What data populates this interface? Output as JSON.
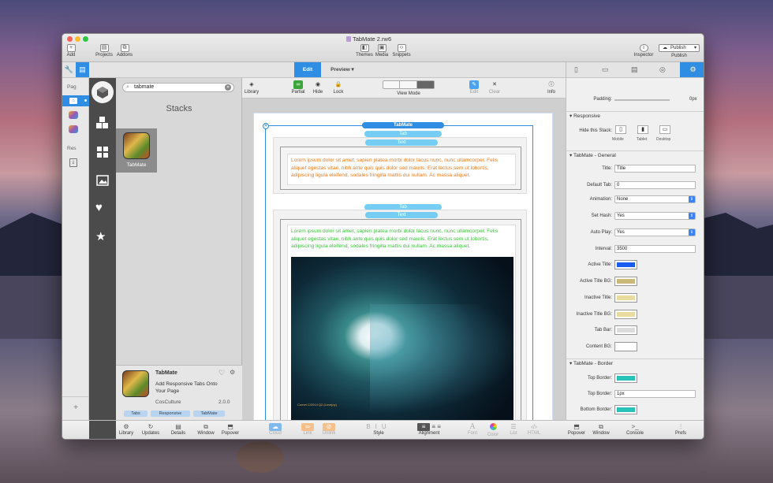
{
  "window": {
    "title": "TabMate 2.rw6",
    "toolbar_left": [
      "Add",
      "Projects",
      "Addons"
    ],
    "toolbar_center": [
      "Themes",
      "Media",
      "Snippets"
    ],
    "toolbar_right": [
      "Inspector",
      "Publish"
    ],
    "publish_button": "Publish"
  },
  "modes": {
    "edit": "Edit",
    "preview": "Preview"
  },
  "sidebar": {
    "pages_label": "Pag",
    "resources_label": "Res"
  },
  "library": {
    "search_value": "tabmate",
    "heading": "Stacks",
    "tile_label": "TabMate",
    "detail": {
      "name": "TabMate",
      "description": "Add Responsive Tabs Onto Your Page",
      "author": "CosCulture",
      "version": "2.0.0",
      "tags": [
        "Tabs",
        "Responsive",
        "TabMate"
      ]
    }
  },
  "stack_toolbar": [
    "Library",
    "Partial",
    "Hide",
    "Lock",
    "View Mode",
    "Edit",
    "Clear",
    "Info"
  ],
  "canvas": {
    "top_pill": "TabMate",
    "tab_pill": "Tab",
    "text_pill": "Text",
    "lorem": "Lorem ipsum dolor sit amet, sapien platea morbi dolor lacus nunc, nunc ullamcorper. Felis aliquet egestas vitae, nibh ante quis quis dolor sed mauris. Erat lectus sem ut lobortis, adipiscing ligula eleifend, sodales fringilla mattis dui nullam. Ac massa aliquet."
  },
  "inspector": {
    "padding_label": "Padding:",
    "padding_unit": "0px",
    "responsive": {
      "header": "Responsive",
      "hide_label": "Hide this Stack:",
      "devices": [
        "Mobile",
        "Tablet",
        "Desktop"
      ]
    },
    "general": {
      "header": "TabMate - General",
      "title_label": "Title:",
      "title_value": "Title",
      "default_tab_label": "Default Tab:",
      "default_tab_value": "0",
      "animation_label": "Animation:",
      "animation_value": "None",
      "set_hash_label": "Set Hash:",
      "set_hash_value": "Yes",
      "auto_play_label": "Auto Play:",
      "auto_play_value": "Yes",
      "interval_label": "Interval:",
      "interval_value": "3500",
      "active_title_label": "Active Title:",
      "active_title_bg_label": "Active Title BG:",
      "inactive_title_label": "Inactive Title:",
      "inactive_title_bg_label": "Inactive Title BG:",
      "tab_bar_label": "Tab Bar:",
      "content_bg_label": "Content BG:"
    },
    "border": {
      "header": "TabMate - Border",
      "top_border_label": "Top Border:",
      "top_border_width_label": "Top Border:",
      "top_border_width_value": "1px",
      "bottom_border_label": "Bottom Border:"
    }
  },
  "colors": {
    "accent": "#2f8de4",
    "active_title": "#1a5cf0",
    "active_title_bg": "#c8b97a",
    "inactive_title": "#e8dca0",
    "inactive_title_bg": "#e8dca0",
    "tab_bar": "#dcdcdc",
    "content_bg": "#ffffff",
    "top_border": "#27c2b8",
    "bottom_border": "#27c2b8",
    "lorem_orange": "#f07a1a",
    "lorem_green": "#3ac43a",
    "pill_blue": "#75cdf4",
    "pill_dark_blue": "#2f8de4"
  },
  "bottom_bar": {
    "left": [
      "Library",
      "Updates",
      "Details",
      "Window",
      "Popover"
    ],
    "center": [
      "Cloud",
      "Link",
      "Unlink",
      "Style",
      "Alignment",
      "Font",
      "Color",
      "List",
      "HTML"
    ],
    "right": [
      "Popover",
      "Window",
      "Console",
      "Prefs"
    ]
  },
  "image_caption": "Comet C/2014 Q2 (Lovejoy)"
}
